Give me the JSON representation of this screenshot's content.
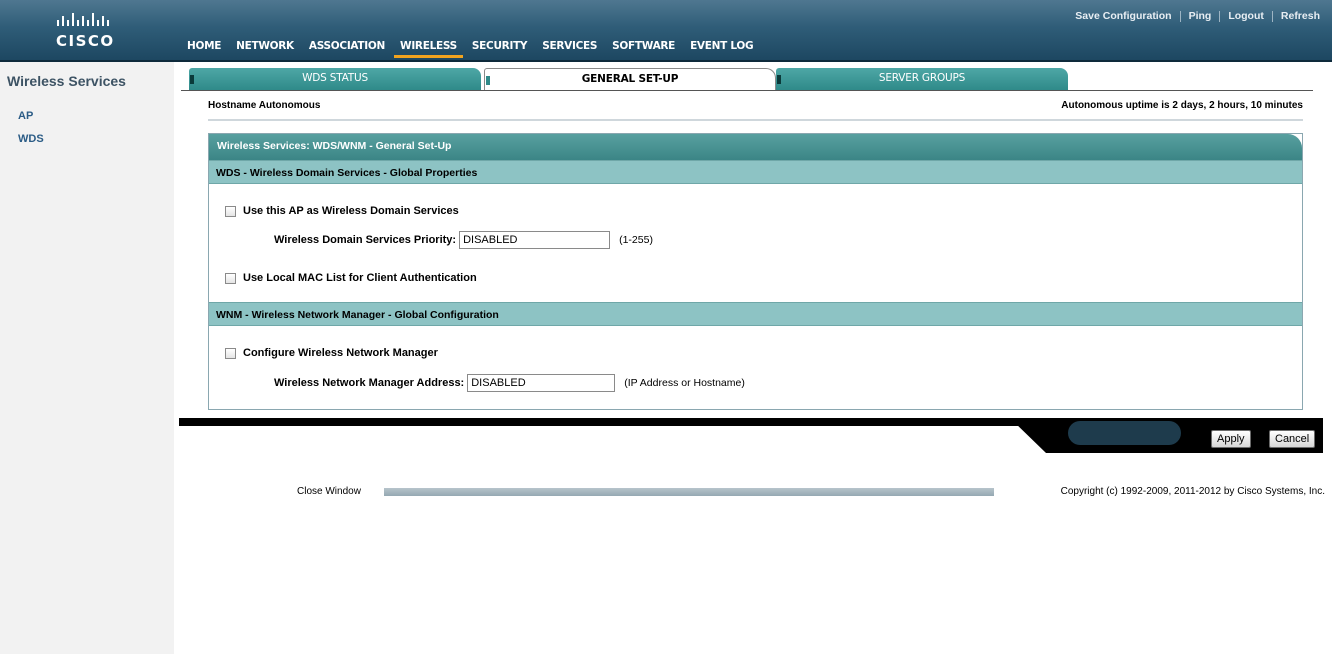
{
  "brand": {
    "name": "CISCO"
  },
  "util_links": [
    "Save Configuration",
    "Ping",
    "Logout",
    "Refresh"
  ],
  "nav": [
    "HOME",
    "NETWORK",
    "ASSOCIATION",
    "WIRELESS",
    "SECURITY",
    "SERVICES",
    "SOFTWARE",
    "EVENT LOG"
  ],
  "nav_active": "WIRELESS",
  "sidebar": {
    "title": "Wireless Services",
    "items": [
      "AP",
      "WDS"
    ]
  },
  "tabs": [
    "WDS STATUS",
    "GENERAL SET-UP",
    "SERVER GROUPS"
  ],
  "active_tab": "GENERAL SET-UP",
  "host": {
    "label": "Hostname Autonomous",
    "uptime": "Autonomous uptime is 2 days, 2 hours, 10 minutes"
  },
  "panel": {
    "title": "Wireless Services: WDS/WNM - General Set-Up",
    "wds": {
      "heading": "WDS - Wireless Domain Services - Global Properties",
      "use_ap_label": "Use this AP as Wireless Domain Services",
      "use_ap_checked": false,
      "priority_label": "Wireless Domain Services Priority:",
      "priority_value": "DISABLED",
      "priority_hint": "(1-255)",
      "local_mac_label": "Use Local MAC List for Client Authentication",
      "local_mac_checked": false
    },
    "wnm": {
      "heading": "WNM - Wireless Network Manager - Global Configuration",
      "configure_label": "Configure Wireless Network Manager",
      "configure_checked": false,
      "address_label": "Wireless Network Manager Address:",
      "address_value": "DISABLED",
      "address_hint": "(IP Address or Hostname)"
    }
  },
  "buttons": {
    "apply": "Apply",
    "cancel": "Cancel"
  },
  "footer": {
    "close": "Close Window",
    "copyright": "Copyright (c) 1992-2009, 2011-2012 by Cisco Systems, Inc."
  },
  "colors": {
    "header": "#2f5d78",
    "tab": "#3f9998",
    "section": "#8dc3c4",
    "active_underline": "#f0a31f",
    "link": "#2b5c86"
  }
}
